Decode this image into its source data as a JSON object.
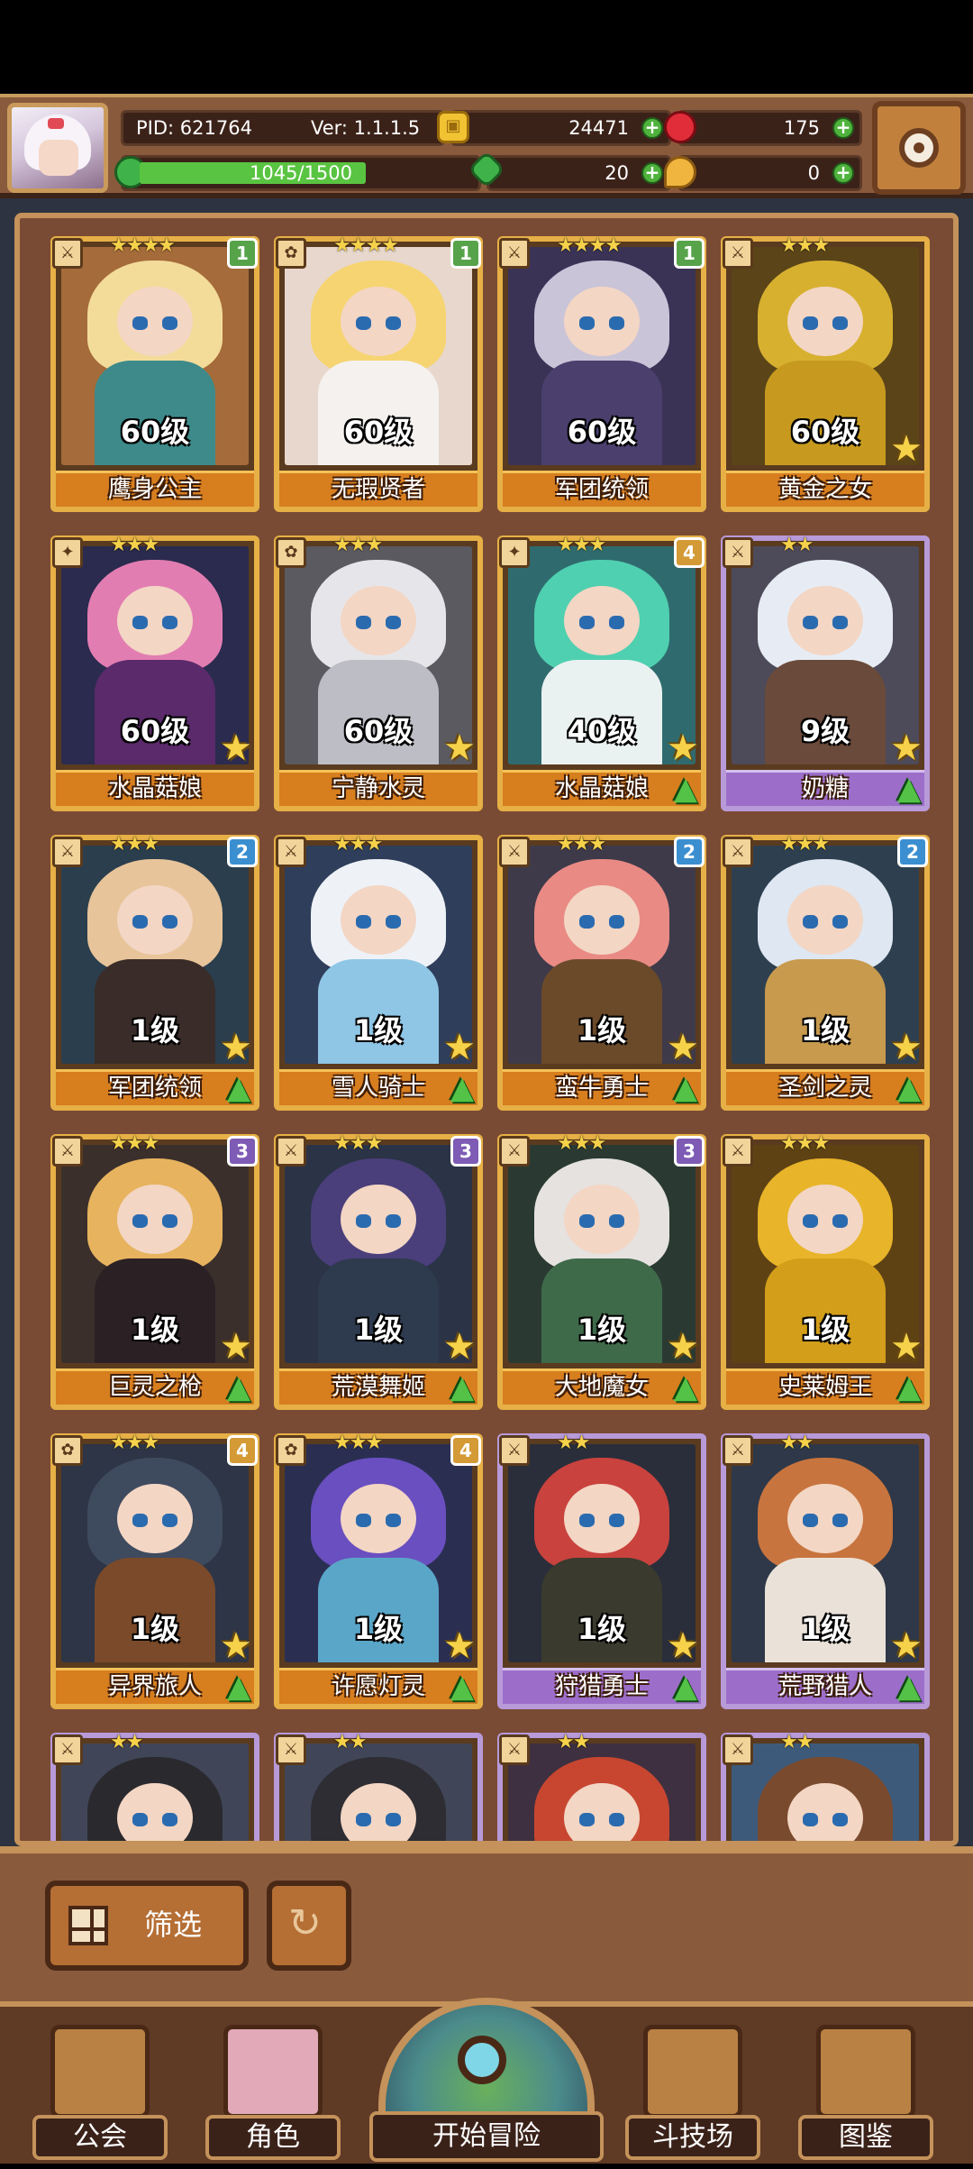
{
  "header": {
    "pid": "PID: 621764",
    "version": "Ver: 1.1.1.5",
    "gold": "24471",
    "gems": "175",
    "xp_text": "1045/1500",
    "xp_fraction": 0.697,
    "clover": "20",
    "seeds": "0"
  },
  "cards": [
    {
      "level": "60级",
      "name": "鹰身公主",
      "stars": "★★★★",
      "badge": "1",
      "badge_class": "b1",
      "frame": "gold",
      "role": "⚔",
      "hair": "#f3dc9a",
      "body": "#3e8a8a",
      "bg": "#a56b3a",
      "star_icon": false,
      "up_icon": false
    },
    {
      "level": "60级",
      "name": "无瑕贤者",
      "stars": "★★★★",
      "badge": "1",
      "badge_class": "b1",
      "frame": "gold",
      "role": "✿",
      "hair": "#f6d471",
      "body": "#f4f1ee",
      "bg": "#e8d7cc",
      "star_icon": false,
      "up_icon": false
    },
    {
      "level": "60级",
      "name": "军团统领",
      "stars": "★★★★",
      "badge": "1",
      "badge_class": "b1",
      "frame": "gold",
      "role": "⚔",
      "hair": "#c9c4d8",
      "body": "#4b3f6e",
      "bg": "#3a3356",
      "star_icon": false,
      "up_icon": false
    },
    {
      "level": "60级",
      "name": "黄金之女",
      "stars": "★★★",
      "badge": "",
      "badge_class": "",
      "frame": "gold",
      "role": "⚔",
      "hair": "#d7b030",
      "body": "#c79a1f",
      "bg": "#5a4418",
      "star_icon": true,
      "up_icon": false
    },
    {
      "level": "60级",
      "name": "水晶菇娘",
      "stars": "★★★",
      "badge": "",
      "badge_class": "",
      "frame": "gold",
      "role": "✦",
      "hair": "#e27db2",
      "body": "#5a2a6a",
      "bg": "#2a2b4e",
      "star_icon": true,
      "up_icon": false
    },
    {
      "level": "60级",
      "name": "宁静水灵",
      "stars": "★★★",
      "badge": "",
      "badge_class": "",
      "frame": "gold",
      "role": "✿",
      "hair": "#e6e6ea",
      "body": "#bdbdc6",
      "bg": "#5a5a60",
      "star_icon": true,
      "up_icon": false
    },
    {
      "level": "40级",
      "name": "水晶菇娘",
      "stars": "★★★",
      "badge": "4",
      "badge_class": "b4",
      "frame": "gold",
      "role": "✦",
      "hair": "#4fd0b0",
      "body": "#eaf1f1",
      "bg": "#2f6b6e",
      "star_icon": true,
      "up_icon": true
    },
    {
      "level": "9级",
      "name": "奶糖",
      "stars": "★★",
      "badge": "",
      "badge_class": "",
      "frame": "purple",
      "role": "⚔",
      "hair": "#e7ecf4",
      "body": "#6a4a3a",
      "bg": "#4d4a5a",
      "star_icon": true,
      "up_icon": true
    },
    {
      "level": "1级",
      "name": "军团统领",
      "stars": "★★★",
      "badge": "2",
      "badge_class": "b2",
      "frame": "gold",
      "role": "⚔",
      "hair": "#e8c49a",
      "body": "#3a2c28",
      "bg": "#2a3e4e",
      "star_icon": true,
      "up_icon": true
    },
    {
      "level": "1级",
      "name": "雪人骑士",
      "stars": "★★★",
      "badge": "",
      "badge_class": "",
      "frame": "gold",
      "role": "⚔",
      "hair": "#eef2f7",
      "body": "#8fc6e6",
      "bg": "#2f3e5a",
      "star_icon": true,
      "up_icon": true
    },
    {
      "level": "1级",
      "name": "蛮牛勇士",
      "stars": "★★★",
      "badge": "2",
      "badge_class": "b2",
      "frame": "gold",
      "role": "⚔",
      "hair": "#e98a84",
      "body": "#6b4a2a",
      "bg": "#3e3a4a",
      "star_icon": true,
      "up_icon": true
    },
    {
      "level": "1级",
      "name": "圣剑之灵",
      "stars": "★★★",
      "badge": "2",
      "badge_class": "b2",
      "frame": "gold",
      "role": "⚔",
      "hair": "#dfe7f2",
      "body": "#c89a4e",
      "bg": "#2e4050",
      "star_icon": true,
      "up_icon": true
    },
    {
      "level": "1级",
      "name": "巨灵之枪",
      "stars": "★★★",
      "badge": "3",
      "badge_class": "b3",
      "frame": "gold",
      "role": "⚔",
      "hair": "#e7b35e",
      "body": "#2b2024",
      "bg": "#3a2f2b",
      "star_icon": true,
      "up_icon": true
    },
    {
      "level": "1级",
      "name": "荒漠舞姬",
      "stars": "★★★",
      "badge": "3",
      "badge_class": "b3",
      "frame": "gold",
      "role": "⚔",
      "hair": "#4a3f7a",
      "body": "#2e3a4e",
      "bg": "#2b3347",
      "star_icon": true,
      "up_icon": true
    },
    {
      "level": "1级",
      "name": "大地魔女",
      "stars": "★★★",
      "badge": "3",
      "badge_class": "b3",
      "frame": "gold",
      "role": "⚔",
      "hair": "#e5e2e0",
      "body": "#3f6a4a",
      "bg": "#2a3a33",
      "star_icon": true,
      "up_icon": true
    },
    {
      "level": "1级",
      "name": "史莱姆王",
      "stars": "★★★",
      "badge": "",
      "badge_class": "",
      "frame": "gold",
      "role": "⚔",
      "hair": "#e8b429",
      "body": "#d39e1a",
      "bg": "#5e4214",
      "star_icon": true,
      "up_icon": true
    },
    {
      "level": "1级",
      "name": "异界旅人",
      "stars": "★★★",
      "badge": "4",
      "badge_class": "b4",
      "frame": "gold",
      "role": "✿",
      "hair": "#3e4a5e",
      "body": "#7a4a2a",
      "bg": "#2d3546",
      "star_icon": true,
      "up_icon": true
    },
    {
      "level": "1级",
      "name": "许愿灯灵",
      "stars": "★★★",
      "badge": "4",
      "badge_class": "b4",
      "frame": "gold",
      "role": "✿",
      "hair": "#6a4fc0",
      "body": "#5aa6c8",
      "bg": "#2a2f52",
      "star_icon": true,
      "up_icon": true
    },
    {
      "level": "1级",
      "name": "狩猎勇士",
      "stars": "★★",
      "badge": "",
      "badge_class": "",
      "frame": "purple",
      "role": "⚔",
      "hair": "#c9423e",
      "body": "#3a3a2e",
      "bg": "#2a2e3a",
      "star_icon": true,
      "up_icon": true
    },
    {
      "level": "1级",
      "name": "荒野猎人",
      "stars": "★★",
      "badge": "",
      "badge_class": "",
      "frame": "purple",
      "role": "⚔",
      "hair": "#c8743e",
      "body": "#eae2d8",
      "bg": "#2e3848",
      "star_icon": true,
      "up_icon": true
    },
    {
      "level": "",
      "name": "",
      "stars": "★★",
      "badge": "",
      "badge_class": "",
      "frame": "purple",
      "role": "⚔",
      "hair": "#2a2a2e",
      "body": "#3a3a3e",
      "bg": "#404658",
      "star_icon": false,
      "up_icon": false
    },
    {
      "level": "",
      "name": "",
      "stars": "★★",
      "badge": "",
      "badge_class": "",
      "frame": "purple",
      "role": "⚔",
      "hair": "#2d2d33",
      "body": "#3a3a3e",
      "bg": "#404658",
      "star_icon": false,
      "up_icon": false
    },
    {
      "level": "",
      "name": "",
      "stars": "★★",
      "badge": "",
      "badge_class": "",
      "frame": "purple",
      "role": "⚔",
      "hair": "#c84630",
      "body": "#3a3a3e",
      "bg": "#3e3040",
      "star_icon": false,
      "up_icon": false
    },
    {
      "level": "",
      "name": "",
      "stars": "★★",
      "badge": "",
      "badge_class": "",
      "frame": "purple",
      "role": "⚔",
      "hair": "#7a4a2e",
      "body": "#3a3a3e",
      "bg": "#3e5a7a",
      "star_icon": false,
      "up_icon": false
    }
  ],
  "filter": {
    "label": "筛选"
  },
  "nav": {
    "guild": "公会",
    "character": "角色",
    "adventure": "开始冒险",
    "arena": "斗技场",
    "codex": "图鉴"
  }
}
